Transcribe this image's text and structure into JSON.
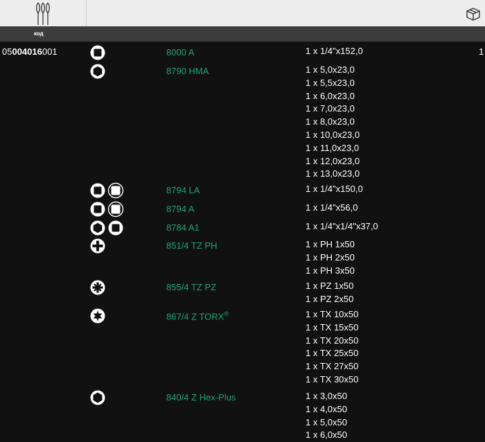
{
  "header": {
    "column_label": "код"
  },
  "article": {
    "prefix": "05",
    "bold": "004016",
    "suffix": "001"
  },
  "total_quantity": "1",
  "rows": [
    {
      "icons": [
        "square-drive-icon"
      ],
      "code": "8000 A",
      "sup": "",
      "sizes": [
        "1 x 1/4\"x152,0"
      ]
    },
    {
      "icons": [
        "hexagon-socket-icon"
      ],
      "code": "8790 HMA",
      "sup": "",
      "sizes": [
        "1 x 5,0x23,0",
        "1 x 5,5x23,0",
        "1 x 6,0x23,0",
        "1 x 7,0x23,0",
        "1 x 8,0x23,0",
        "1 x 10,0x23,0",
        "1 x 11,0x23,0",
        "1 x 12,0x23,0",
        "1 x 13,0x23,0"
      ]
    },
    {
      "icons": [
        "square-drive-icon",
        "square-socket-icon"
      ],
      "code": "8794 LA",
      "sup": "",
      "sizes": [
        "1 x 1/4\"x150,0"
      ]
    },
    {
      "icons": [
        "square-drive-icon",
        "square-socket-icon"
      ],
      "code": "8794 A",
      "sup": "",
      "sizes": [
        "1 x 1/4\"x56,0"
      ]
    },
    {
      "icons": [
        "hexagon-socket-icon",
        "square-drive-icon"
      ],
      "code": "8784 A1",
      "sup": "",
      "sizes": [
        "1 x 1/4\"x1/4\"x37,0"
      ]
    },
    {
      "icons": [
        "phillips-icon"
      ],
      "code": "851/4 TZ PH",
      "sup": "",
      "sizes": [
        "1 x PH 1x50",
        "1 x PH 2x50",
        "1 x PH 3x50"
      ]
    },
    {
      "icons": [
        "pozidriv-icon"
      ],
      "code": "855/4 TZ PZ",
      "sup": "",
      "sizes": [
        "1 x PZ 1x50",
        "1 x PZ 2x50"
      ]
    },
    {
      "icons": [
        "torx-icon"
      ],
      "code": "867/4 Z TORX",
      "sup": "®",
      "sizes": [
        "1 x TX 10x50",
        "1 x TX 15x50",
        "1 x TX 20x50",
        "1 x TX 25x50",
        "1 x TX 27x50",
        "1 x TX 30x50"
      ]
    },
    {
      "icons": [
        "hex-plus-icon"
      ],
      "code": "840/4 Z Hex-Plus",
      "sup": "",
      "sizes": [
        "1 x 3,0x50",
        "1 x 4,0x50",
        "1 x 5,0x50",
        "1 x 6,0x50"
      ]
    }
  ]
}
